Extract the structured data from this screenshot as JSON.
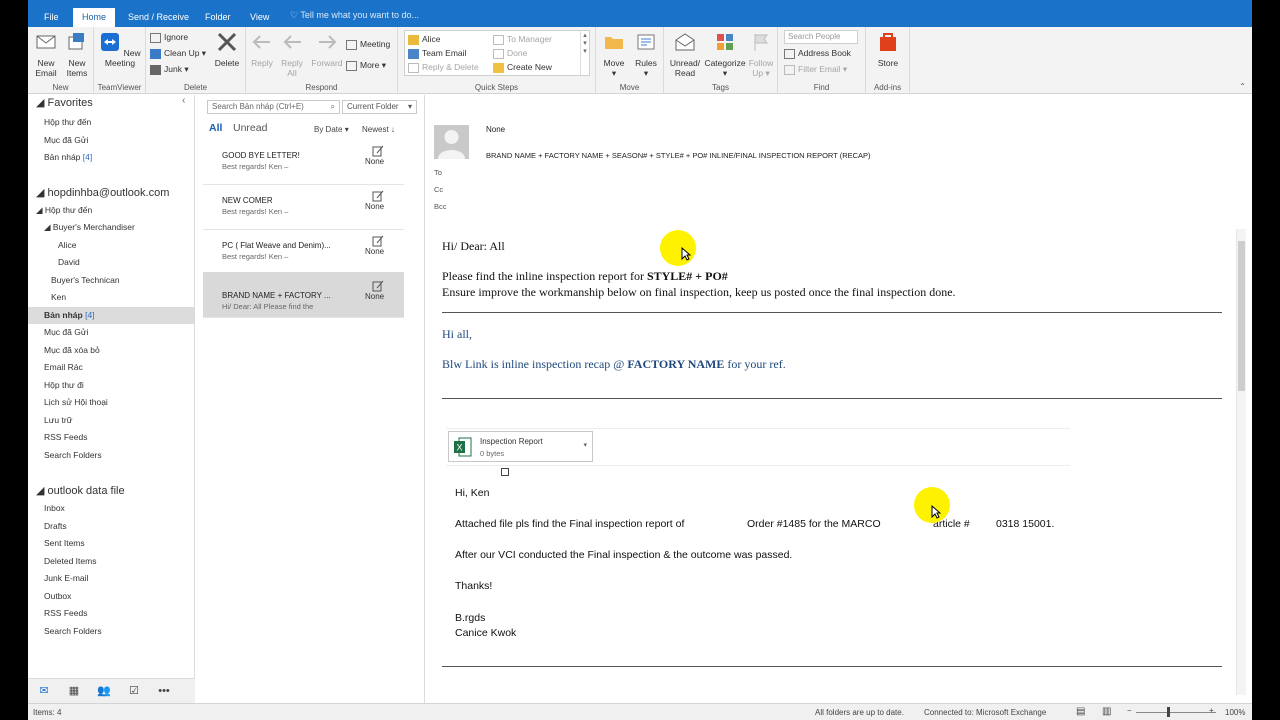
{
  "tabs": {
    "file": "File",
    "home": "Home",
    "send_receive": "Send / Receive",
    "folder": "Folder",
    "view": "View",
    "tell_me": "Tell me what you want to do..."
  },
  "ribbon": {
    "new": {
      "new_email": "New Email",
      "new_items": "New Items",
      "label": "New"
    },
    "teamviewer": {
      "new_meeting": "New Meeting",
      "label": "TeamViewer"
    },
    "delete": {
      "ignore": "Ignore",
      "clean_up": "Clean Up",
      "junk": "Junk",
      "delete": "Delete",
      "label": "Delete"
    },
    "respond": {
      "reply": "Reply",
      "reply_all": "Reply All",
      "forward": "Forward",
      "meeting": "Meeting",
      "more": "More",
      "label": "Respond"
    },
    "quick_steps": {
      "items": [
        "Alice",
        "Team Email",
        "Reply & Delete",
        "To Manager",
        "Done",
        "Create New"
      ],
      "label": "Quick Steps"
    },
    "move": {
      "move": "Move",
      "rules": "Rules",
      "label": "Move"
    },
    "tags": {
      "unread_read": "Unread/ Read",
      "categorize": "Categorize",
      "follow_up": "Follow Up",
      "label": "Tags"
    },
    "find": {
      "search_people": "Search People",
      "address_book": "Address Book",
      "filter_email": "Filter Email",
      "label": "Find"
    },
    "addins": {
      "store": "Store",
      "label": "Add-ins"
    }
  },
  "nav": {
    "favorites": "Favorites",
    "fav_items": [
      "Hộp thư đến",
      "Mục đã Gửi",
      "Bản nháp"
    ],
    "fav_drafts_count": "[4]",
    "account": "hopdinhba@outlook.com",
    "inbox": "Hộp thư đến",
    "buyers_merch": "Buyer's Merchandiser",
    "alice": "Alice",
    "david": "David",
    "buyers_tech": "Buyer's Technican",
    "ken": "Ken",
    "drafts": "Bản nháp",
    "drafts_count": "[4]",
    "rest": [
      "Mục đã Gửi",
      "Mục đã xóa bỏ",
      "Email Rác",
      "Hộp thư đi",
      "Lịch sử Hội thoại",
      "Lưu trữ",
      "RSS Feeds",
      "Search Folders"
    ],
    "datafile": "outlook data file",
    "datafile_items": [
      "Inbox",
      "Drafts",
      "Sent Items",
      "Deleted Items",
      "Junk E-mail",
      "Outbox",
      "RSS Feeds",
      "Search Folders"
    ]
  },
  "list": {
    "search_placeholder": "Search Bản nháp (Ctrl+E)",
    "scope": "Current Folder",
    "all": "All",
    "unread": "Unread",
    "by_date": "By Date",
    "newest": "Newest",
    "messages": [
      {
        "subject": "GOOD BYE LETTER!",
        "preview": "Best regards!  Ken –",
        "date": "None"
      },
      {
        "subject": "NEW COMER",
        "preview": "Best regards!  Ken –",
        "date": "None"
      },
      {
        "subject": "PC ( Flat Weave and Denim)...",
        "preview": "Best regards!  Ken –",
        "date": "None"
      },
      {
        "subject": "BRAND NAME + FACTORY ...",
        "preview": "Hi/ Dear: All  Please find the",
        "date": "None"
      }
    ]
  },
  "reading": {
    "from": "None",
    "subject": "BRAND NAME + FACTORY NAME + SEASON# + STYLE# + PO# INLINE/FINAL INSPECTION REPORT (RECAP)",
    "to": "To",
    "cc": "Cc",
    "bcc": "Bcc",
    "greeting": "Hi/ Dear: All",
    "line1_a": "Please find the inline inspection report for ",
    "line1_b": "STYLE# + PO#",
    "line2": "Ensure improve the workmanship below on final inspection, keep us posted once the final inspection done.",
    "hi_all": "Hi all,",
    "blw_a": "Blw Link is inline inspection recap @ ",
    "blw_b": "FACTORY NAME",
    "blw_c": " for your ref.",
    "attach_name": "Inspection Report",
    "attach_size": "0 bytes",
    "hi_ken": "Hi, Ken",
    "attached_a": "Attached file pls find the Final inspection report of",
    "attached_b": "Order #1485 for the  MARCO",
    "attached_c": "article #",
    "attached_d": "0318 15001.",
    "after": "After our VCI conducted the Final inspection & the outcome was passed.",
    "thanks": "Thanks!",
    "brgds": "B.rgds",
    "sig": "Canice Kwok"
  },
  "status": {
    "items": "Items: 4",
    "uptodate": "All folders are up to date.",
    "connected": "Connected to: Microsoft Exchange",
    "zoom": "100%"
  }
}
